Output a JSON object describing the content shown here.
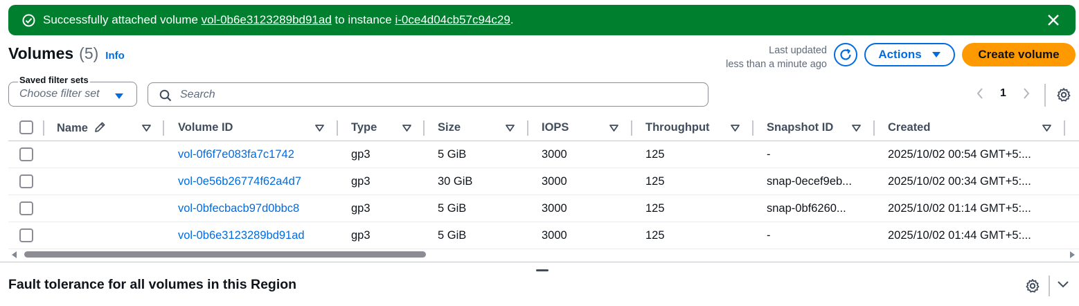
{
  "flash": {
    "prefix": "Successfully attached volume ",
    "volume_link": "vol-0b6e3123289bd91ad",
    "middle": " to instance ",
    "instance_link": "i-0ce4d04cb57c94c29",
    "suffix": "."
  },
  "header": {
    "title": "Volumes",
    "count": "(5)",
    "info": "Info",
    "last_updated_label": "Last updated",
    "last_updated_value": "less than a minute ago",
    "actions_label": "Actions",
    "create_label": "Create volume"
  },
  "filters": {
    "saved_label": "Saved filter sets",
    "saved_placeholder": "Choose filter set",
    "search_placeholder": "Search"
  },
  "pagination": {
    "current_page": "1"
  },
  "table": {
    "columns": [
      "Name",
      "Volume ID",
      "Type",
      "Size",
      "IOPS",
      "Throughput",
      "Snapshot ID",
      "Created"
    ],
    "rows": [
      {
        "name": "",
        "volume_id": "vol-0f6f7e083fa7c1742",
        "type": "gp3",
        "size": "5 GiB",
        "iops": "3000",
        "throughput": "125",
        "snapshot": "-",
        "created": "2025/10/02 00:54 GMT+5:..."
      },
      {
        "name": "",
        "volume_id": "vol-0e56b26774f62a4d7",
        "type": "gp3",
        "size": "30 GiB",
        "iops": "3000",
        "throughput": "125",
        "snapshot": "snap-0ecef9eb...",
        "created": "2025/10/02 00:34 GMT+5:..."
      },
      {
        "name": "",
        "volume_id": "vol-0bfecbacb97d0bbc8",
        "type": "gp3",
        "size": "5 GiB",
        "iops": "3000",
        "throughput": "125",
        "snapshot": "snap-0bf6260...",
        "created": "2025/10/02 01:14 GMT+5:..."
      },
      {
        "name": "",
        "volume_id": "vol-0b6e3123289bd91ad",
        "type": "gp3",
        "size": "5 GiB",
        "iops": "3000",
        "throughput": "125",
        "snapshot": "-",
        "created": "2025/10/02 01:44 GMT+5:..."
      }
    ]
  },
  "lower_panel": {
    "title": "Fault tolerance for all volumes in this Region"
  },
  "colors": {
    "success": "#00802f",
    "link": "#006ce0",
    "primary_button": "#ff9900"
  },
  "icons": [
    "check-circle-icon",
    "close-icon",
    "refresh-icon",
    "caret-down-icon",
    "search-icon",
    "chevron-left-icon",
    "chevron-right-icon",
    "gear-icon",
    "pencil-icon",
    "sort-icon",
    "chevron-down-icon"
  ]
}
